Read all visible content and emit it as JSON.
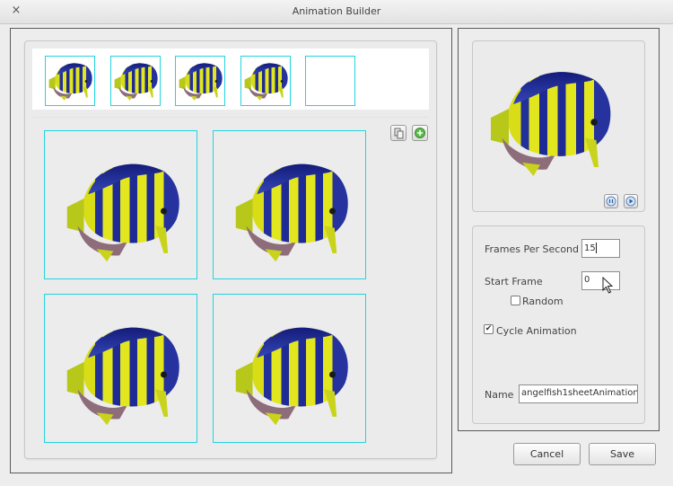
{
  "window": {
    "title": "Animation Builder",
    "close_icon": "×"
  },
  "frames_strip": {
    "thumbnail_count": 4,
    "empty_slot": true
  },
  "frame_tools": {
    "copy_icon": "copy-icon",
    "add_icon": "add-icon"
  },
  "frame_grid": {
    "frame_count": 4
  },
  "preview": {
    "pause_icon": "pause-icon",
    "play_icon": "play-icon"
  },
  "properties": {
    "fps_label": "Frames Per Second",
    "fps_value": "15",
    "start_frame_label": "Start Frame",
    "start_frame_value": "0",
    "random_label": "Random",
    "random_checked": false,
    "cycle_label": "Cycle Animation",
    "cycle_checked": true,
    "name_label": "Name",
    "name_value": "angelfish1sheetAnimation"
  },
  "buttons": {
    "cancel": "Cancel",
    "save": "Save"
  },
  "colors": {
    "frame_border": "#22d3e0",
    "fish_blue": "#1f2a9a",
    "fish_yellow": "#dde21a"
  }
}
